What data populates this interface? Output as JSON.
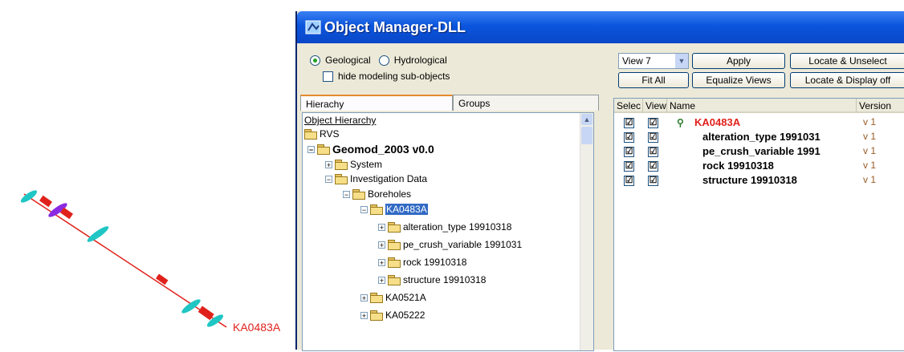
{
  "viewport": {
    "borehole_label": "KA0483A",
    "colors": {
      "line": "#e0211b",
      "disk": "#1fc6c4",
      "marker": "#8a2be2"
    }
  },
  "window": {
    "title": "Object Manager-DLL",
    "radio_geological": "Geological",
    "radio_hydrological": "Hydrological",
    "hide_checkbox_label": "hide modeling sub-objects",
    "tabs": [
      "Hierachy",
      "Groups"
    ],
    "tree_header": "Object Hierarchy",
    "tree": [
      {
        "label": "RVS",
        "expander": ""
      },
      {
        "label": "Geomod_2003  v0.0",
        "expander": "−"
      },
      {
        "label": "System",
        "expander": "+"
      },
      {
        "label": "Investigation Data",
        "expander": "−"
      },
      {
        "label": "Boreholes",
        "expander": "−"
      },
      {
        "label": "KA0483A",
        "expander": "−"
      },
      {
        "label": "alteration_type 19910318",
        "expander": "+"
      },
      {
        "label": "pe_crush_variable 1991031",
        "expander": "+"
      },
      {
        "label": "rock 19910318",
        "expander": "+"
      },
      {
        "label": "structure 19910318",
        "expander": "+"
      },
      {
        "label": "KA0521A",
        "expander": "+"
      },
      {
        "label": "KA05222",
        "expander": "+"
      }
    ],
    "buttons": {
      "view_select": "View 7",
      "apply": "Apply",
      "locate_unselect": "Locate & Unselect",
      "fit_all": "Fit All",
      "equalize_views": "Equalize Views",
      "locate_display_off": "Locate & Display off"
    },
    "grid": {
      "headers": [
        "Selec",
        "View",
        "Name",
        "Version"
      ],
      "rows": [
        {
          "name": "KA0483A",
          "version": "v 1",
          "sel": "☑",
          "view": "☑"
        },
        {
          "name": "alteration_type 1991031",
          "version": "v 1",
          "sel": "☑",
          "view": "☑"
        },
        {
          "name": "pe_crush_variable 1991",
          "version": "v 1",
          "sel": "☑",
          "view": "☑"
        },
        {
          "name": "rock 19910318",
          "version": "v 1",
          "sel": "☑",
          "view": "☑"
        },
        {
          "name": "structure 19910318",
          "version": "v 1",
          "sel": "☑",
          "view": "☑"
        }
      ]
    }
  }
}
